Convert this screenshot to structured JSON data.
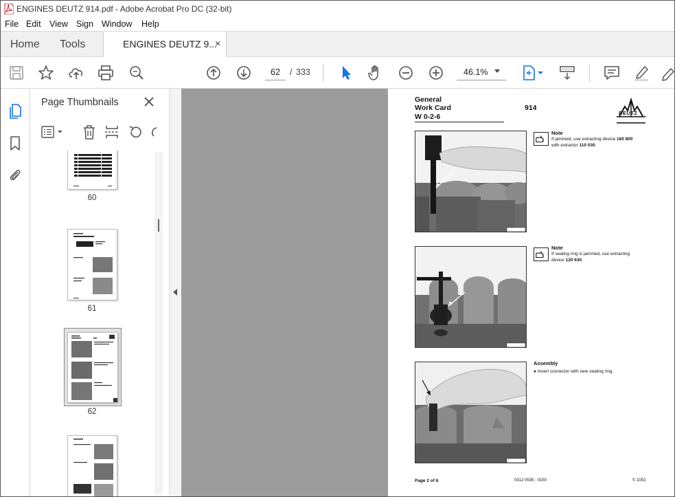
{
  "window": {
    "title": "ENGINES DEUTZ 914.pdf - Adobe Acrobat Pro DC (32-bit)"
  },
  "menu": [
    "File",
    "Edit",
    "View",
    "Sign",
    "Window",
    "Help"
  ],
  "tabs": {
    "home": "Home",
    "tools": "Tools",
    "document": "ENGINES DEUTZ 9...",
    "close_glyph": "×"
  },
  "toolbar": {
    "current_page": "62",
    "separator": "/",
    "total_pages": "333",
    "zoom": "46.1%",
    "accent_color": "#1473e6"
  },
  "thumbnail_panel": {
    "title": "Page Thumbnails",
    "pages": [
      "60",
      "61",
      "62"
    ],
    "selected_page": "62"
  },
  "document_page": {
    "header_general": "General",
    "header_workcard": "Work Card",
    "header_code": "W 0-2-6",
    "header_model": "914",
    "logo_text": "DEUTZ",
    "note1_label": "Note",
    "note1_text_a": "If jammed, use extracting device ",
    "note1_num_a": "160 800",
    "note1_text_b": "with extractor ",
    "note1_num_b": "110 030",
    "note1_text_c": ".",
    "note2_label": "Note",
    "note2_text_a": "If sealing ring is jammed, use extracting",
    "note2_text_b": "device ",
    "note2_num": "120 630",
    "note2_text_c": ".",
    "assembly_label": "Assembly",
    "assembly_bullet": "●",
    "assembly_text": "Insert connector with new sealing ring.",
    "footer_left": "Page 2 of 6",
    "footer_center": "0312 0535 - 0150",
    "footer_right": "© 1002"
  }
}
